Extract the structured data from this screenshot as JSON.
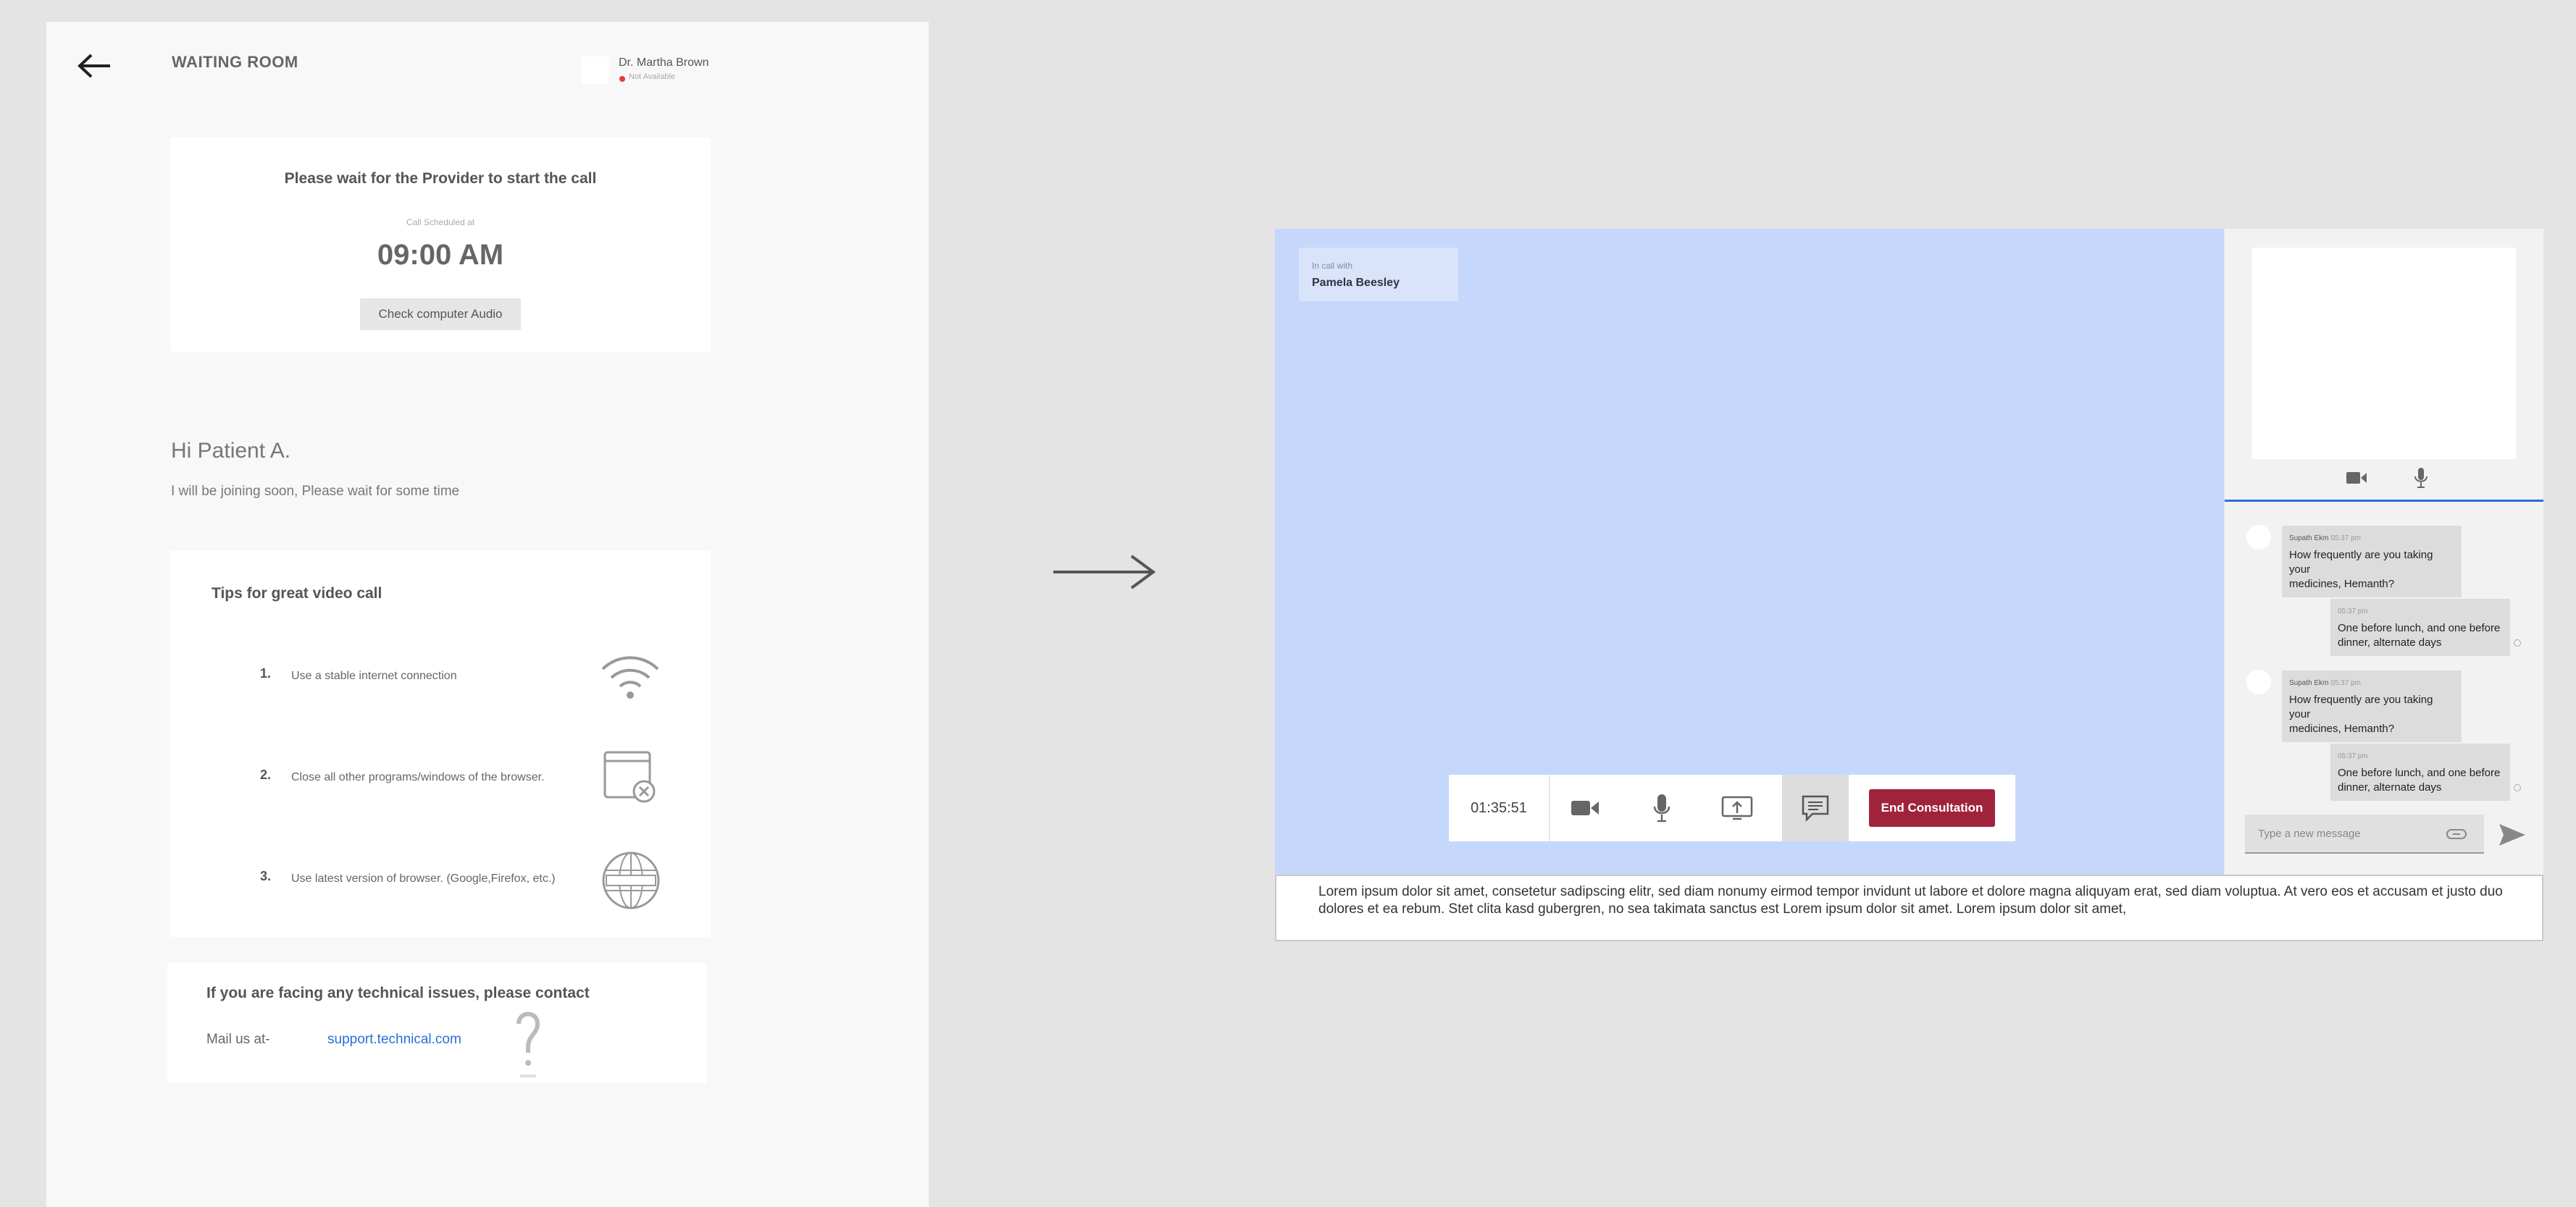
{
  "waiting_room": {
    "title": "WAITING ROOM",
    "doctor": {
      "name": "Dr. Martha Brown",
      "status": "Not Available"
    },
    "wait_card": {
      "heading": "Please wait for the Provider to start the call",
      "scheduled_label": "Call Scheduled at",
      "scheduled_time": "09:00 AM",
      "audio_button": "Check computer Audio"
    },
    "greeting": "Hi Patient A.",
    "greeting_sub": "I will be joining soon, Please wait for some time",
    "tips": {
      "title": "Tips for great video call",
      "items": [
        {
          "num": "1.",
          "text": "Use a stable internet connection",
          "icon": "wifi-icon"
        },
        {
          "num": "2.",
          "text": "Close all other programs/windows of the browser.",
          "icon": "close-window-icon"
        },
        {
          "num": "3.",
          "text": "Use latest version of browser. (Google,Firefox, etc.)",
          "icon": "globe-icon"
        }
      ]
    },
    "support": {
      "title": "If you are facing any technical issues, please contact",
      "mail_prefix": "Mail us at-",
      "mail_link": "support.technical.com"
    }
  },
  "call": {
    "in_call_label": "In call with",
    "in_call_name": "Pamela Beesley",
    "timer": "01:35:51",
    "end_button": "End Consultation",
    "controls": [
      "video-camera-icon",
      "microphone-icon",
      "screen-share-icon",
      "chat-icon"
    ],
    "messages": [
      {
        "side": "left",
        "sender": "Supath Ekm",
        "time": "05:37 pm",
        "text_lines": [
          "How frequently are you taking your",
          "medicines, Hemanth?"
        ]
      },
      {
        "side": "right",
        "time": "05:37 pm",
        "text_lines": [
          "One before lunch, and one before",
          "dinner, alternate days"
        ]
      },
      {
        "side": "left",
        "sender": "Supath Ekm",
        "time": "05:37 pm",
        "text_lines": [
          "How frequently are you taking your",
          "medicines, Hemanth?"
        ]
      },
      {
        "side": "right",
        "time": "05:37 pm",
        "text_lines": [
          "One before lunch, and one before",
          "dinner, alternate days"
        ]
      }
    ],
    "message_placeholder": "Type a new message",
    "caption": "Lorem ipsum dolor sit amet, consetetur sadipscing elitr, sed diam nonumy eirmod tempor invidunt ut labore et dolore magna aliquyam erat, sed diam voluptua. At vero eos et accusam et justo duo dolores et ea rebum. Stet clita kasd gubergren, no sea takimata sanctus est Lorem ipsum dolor sit amet. Lorem ipsum dolor sit amet,"
  },
  "colors": {
    "video_bg": "#c6d7fc",
    "end_button": "#a0233c",
    "link": "#2a6fd6",
    "status_unavailable": "#e53935"
  }
}
